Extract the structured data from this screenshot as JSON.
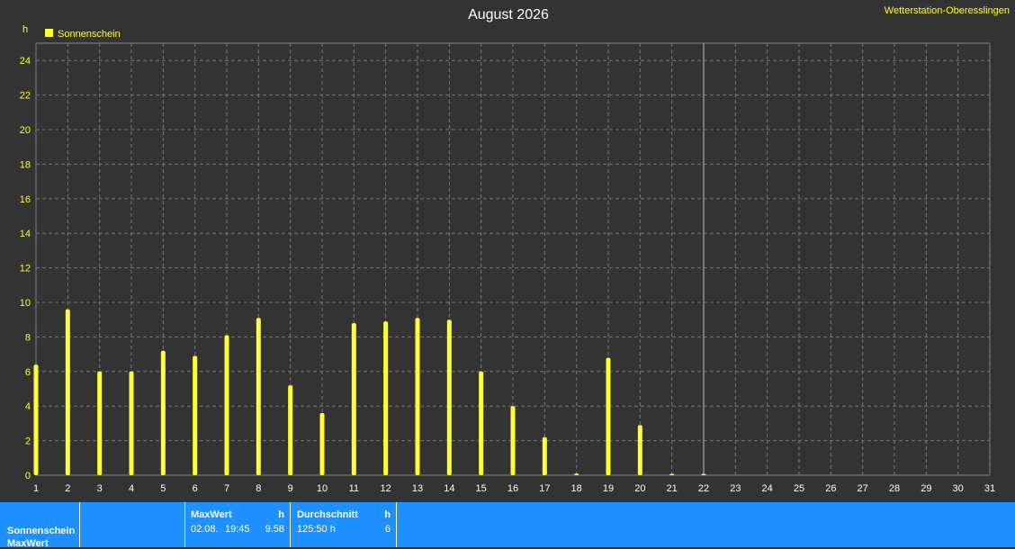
{
  "station": "Wetterstation-Oberesslingen",
  "chart_data": {
    "type": "bar",
    "title": "August 2026",
    "ylabel": "h",
    "ylim": [
      0,
      25
    ],
    "yticks": [
      0,
      2,
      4,
      6,
      8,
      10,
      12,
      14,
      16,
      18,
      20,
      22,
      24
    ],
    "grid": true,
    "legend_position": "top-left",
    "series": [
      {
        "name": "Sonnenschein",
        "color": "#ffff33",
        "x": [
          1,
          2,
          3,
          4,
          5,
          6,
          7,
          8,
          9,
          10,
          11,
          12,
          13,
          14,
          15,
          16,
          17,
          18,
          19,
          20,
          21,
          22
        ],
        "values": [
          6.4,
          9.6,
          6.0,
          6.0,
          7.2,
          6.9,
          8.1,
          9.1,
          5.2,
          3.6,
          8.8,
          8.9,
          9.1,
          9.0,
          6.0,
          4.0,
          2.2,
          0.1,
          6.8,
          2.9,
          0.0,
          0.0
        ]
      }
    ],
    "categories": [
      "1",
      "2",
      "3",
      "4",
      "5",
      "6",
      "7",
      "8",
      "9",
      "10",
      "11",
      "12",
      "13",
      "14",
      "15",
      "16",
      "17",
      "18",
      "19",
      "20",
      "21",
      "22",
      "23",
      "24",
      "25",
      "26",
      "27",
      "28",
      "29",
      "30",
      "31"
    ],
    "current_day_marker": 22
  },
  "footer": {
    "row_label_1": "Sonnenschein",
    "row_label_2": "MaxWert",
    "max_header": "MaxWert",
    "max_unit": "h",
    "max_date": "02.08.",
    "max_time": "19:45",
    "max_value": "9.58",
    "avg_header": "Durchschnitt",
    "avg_unit": "h",
    "avg_total": "125:50 h",
    "avg_value": "6"
  }
}
